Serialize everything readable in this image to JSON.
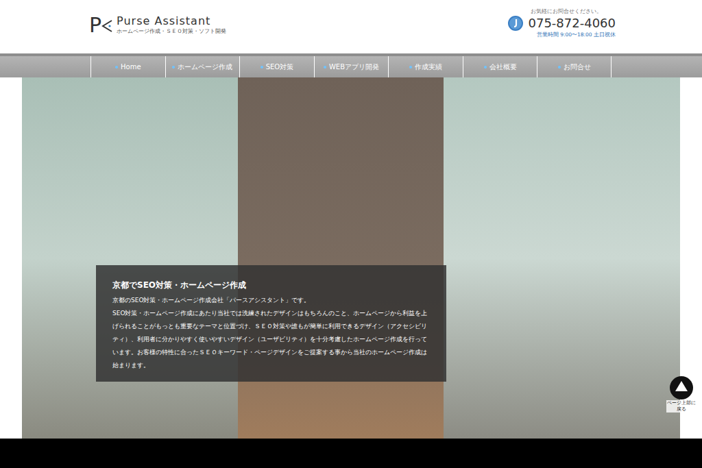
{
  "header": {
    "logo_letter": "P",
    "title": "Purse Assistant",
    "tagline": "ホームページ作成・ＳＥＯ対策・ソフト開発",
    "contact_note": "お気軽にお問合せください。",
    "phone": "075-872-4060",
    "hours": "営業時間 9:00〜18:00 土日祝休"
  },
  "nav": [
    {
      "label": "Home",
      "selected": false
    },
    {
      "label": "ホームページ作成",
      "selected": false
    },
    {
      "label": "SEO対策",
      "selected": false
    },
    {
      "label": "WEBアプリ開発",
      "selected": false
    },
    {
      "label": "作成実績",
      "selected": false
    },
    {
      "label": "会社概要",
      "selected": false
    },
    {
      "label": "お問合せ",
      "selected": false
    }
  ],
  "hero": {
    "title": "京都でSEO対策・ホームページ作成",
    "paragraphs": [
      "京都のSEO対策・ホームページ作成会社「パースアシスタント」です。",
      "SEO対策・ホームページ作成にあたり当社では洗練されたデザインはもちろんのこと、ホームページから利益を上げられることがもっとも重要なテーマと位置づけ、ＳＥＯ対策や誰もが簡単に利用できるデザイン（アクセシビリティ）、利用者に分かりやすく使いやすいデザイン（ユーザビリティ）を十分考慮したホームページ作成を行っています。お客様の特性に合ったＳＥＯキーワード・ページデザインをご提案する事から当社のホームページ作成は始まります。"
    ]
  },
  "back_to_top": {
    "label": "ページ上部に戻る"
  }
}
